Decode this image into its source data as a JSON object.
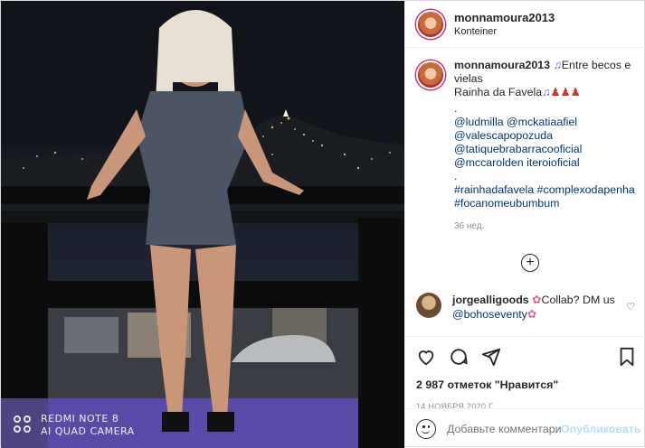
{
  "post": {
    "username": "monnamoura2013",
    "location": "Konteiner"
  },
  "photo": {
    "watermark_line1": "REDMI NOTE 8",
    "watermark_line2": "AI QUAD CAMERA"
  },
  "caption": {
    "username": "monnamoura2013",
    "text_line1": "Entre becos e vielas",
    "text_line2": "Rainha da Favela",
    "dot": ".",
    "mentions": [
      "@ludmilla",
      "@mckatiaafiel",
      "@valescapopozuda",
      "@tatiquebrabarracooficial",
      "@mccarolden iteroioficial"
    ],
    "dot2": ".",
    "hashtags": [
      "#rainhadafavela",
      "#complexodapenha",
      "#focanomeubumbum"
    ],
    "time_ago": "36 нед."
  },
  "comment": {
    "username": "jorgealligoods",
    "text": "Collab? DM us",
    "mention": "@bohoseventy"
  },
  "actions": {
    "likes": "2 987 отметок \"Нравится\"",
    "date": "14 НОЯБРЯ 2020 Г."
  },
  "add_comment": {
    "placeholder": "Добавьте комментарий...",
    "publish_label": "Опубликовать"
  },
  "icons": [
    "heart-icon",
    "comment-icon",
    "share-icon",
    "bookmark-icon",
    "emoji-icon",
    "plus-circle-icon",
    "music-note-icon",
    "flower-icon"
  ],
  "colors": {
    "link": "#00376b",
    "publish_disabled": "#b2dffc",
    "muted": "#8e8e8e"
  }
}
